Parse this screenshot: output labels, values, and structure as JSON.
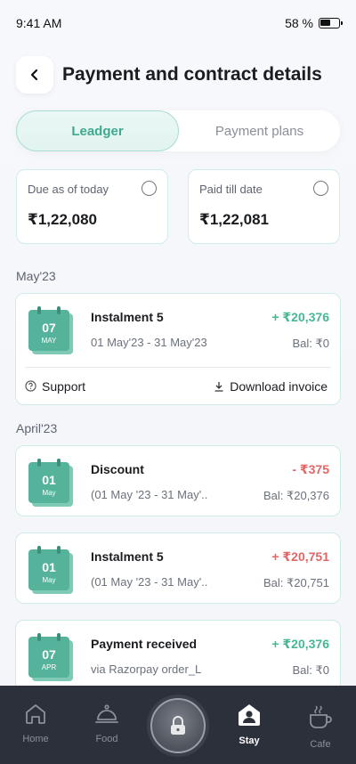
{
  "status": {
    "time": "9:41 AM",
    "battery": "58 %"
  },
  "header": {
    "title": "Payment and contract details"
  },
  "tabs": [
    {
      "label": "Leadger",
      "active": true
    },
    {
      "label": "Payment plans",
      "active": false
    }
  ],
  "summary": [
    {
      "label": "Due as of today",
      "value": "₹1,22,080"
    },
    {
      "label": "Paid till date",
      "value": "₹1,22,081"
    }
  ],
  "months": [
    "May'23",
    "April'23"
  ],
  "transactions": [
    {
      "day": "07",
      "month": "MAY",
      "title": "Instalment 5",
      "subtitle": "01 May'23 - 31 May'23",
      "amount": "+ ₹20,376",
      "balance": "Bal: ₹0",
      "amount_color": "#45b796"
    },
    {
      "day": "01",
      "month": "May",
      "title": "Discount",
      "subtitle": "(01 May '23 - 31 May'..",
      "amount": "- ₹375",
      "balance": "Bal: ₹20,376",
      "amount_color": "#e36565"
    },
    {
      "day": "01",
      "month": "May",
      "title": "Instalment 5",
      "subtitle": "(01 May '23 - 31 May'..",
      "amount": "+ ₹20,751",
      "balance": "Bal: ₹20,751",
      "amount_color": "#e36565"
    },
    {
      "day": "07",
      "month": "APR",
      "title": "Payment received",
      "subtitle": "via Razorpay order_L",
      "amount": "+ ₹20,376",
      "balance": "Bal: ₹0",
      "amount_color": "#45b796"
    }
  ],
  "actions": {
    "support": "Support",
    "download": "Download invoice"
  },
  "nav": [
    {
      "label": "Home",
      "icon": "home-icon"
    },
    {
      "label": "Food",
      "icon": "cloche-icon"
    },
    {
      "label": "",
      "icon": "lock-icon"
    },
    {
      "label": "Stay",
      "icon": "user-house-icon",
      "active": true
    },
    {
      "label": "Cafe",
      "icon": "coffee-cup-icon"
    }
  ],
  "colors": {
    "accent": "#45b796",
    "negative": "#e36565",
    "nav_bg": "#2b303b"
  }
}
